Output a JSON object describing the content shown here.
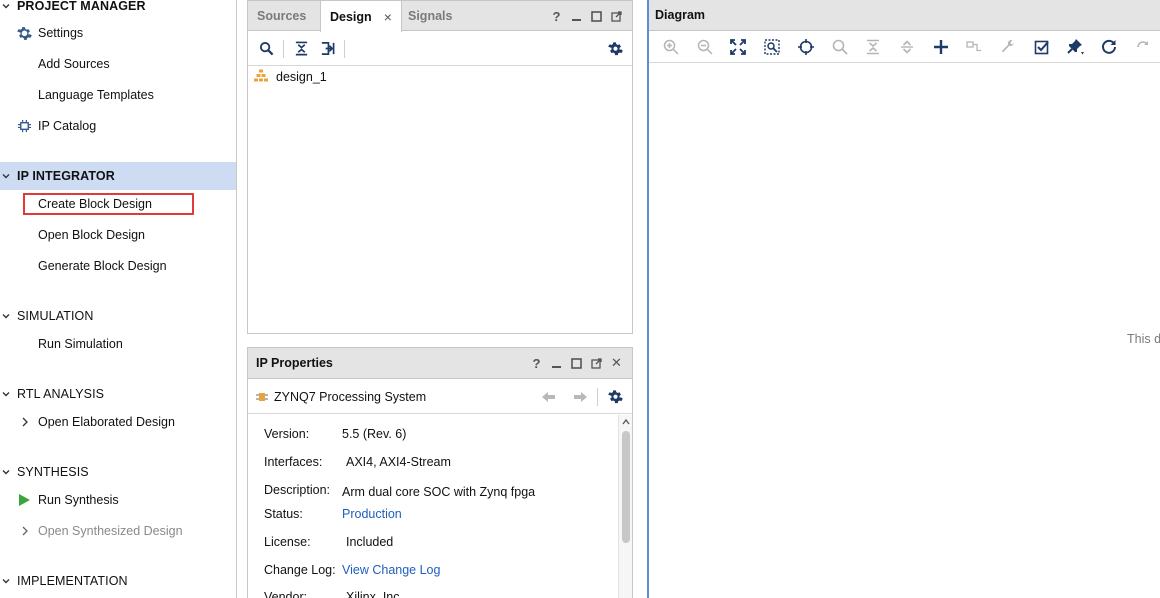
{
  "navigator": {
    "project_manager": {
      "title": "PROJECT MANAGER",
      "items": [
        {
          "label": "Settings",
          "icon": "gear-icon"
        },
        {
          "label": "Add Sources"
        },
        {
          "label": "Language Templates"
        },
        {
          "label": "IP Catalog",
          "icon": "ip-catalog-icon"
        }
      ]
    },
    "ip_integrator": {
      "title": "IP INTEGRATOR",
      "items": [
        {
          "label": "Create Block Design"
        },
        {
          "label": "Open Block Design"
        },
        {
          "label": "Generate Block Design"
        }
      ]
    },
    "simulation": {
      "title": "SIMULATION",
      "items": [
        {
          "label": "Run Simulation"
        }
      ]
    },
    "rtl_analysis": {
      "title": "RTL ANALYSIS",
      "items": [
        {
          "label": "Open Elaborated Design"
        }
      ]
    },
    "synthesis": {
      "title": "SYNTHESIS",
      "items": [
        {
          "label": "Run Synthesis",
          "icon": "run-play-icon"
        },
        {
          "label": "Open Synthesized Design"
        }
      ]
    },
    "implementation": {
      "title": "IMPLEMENTATION"
    }
  },
  "block_design_panel": {
    "tabs": [
      {
        "label": "Sources"
      },
      {
        "label": "Design",
        "close": "×"
      },
      {
        "label": "Signals"
      }
    ],
    "window_controls": {
      "help": "?"
    },
    "tree": [
      {
        "label": "design_1",
        "icon": "hierarchy-icon"
      }
    ]
  },
  "ip_properties": {
    "title": "IP Properties",
    "window_controls": {
      "help": "?",
      "close": "✕"
    },
    "selected_ip": "ZYNQ7 Processing System",
    "properties": [
      {
        "key": "Version:",
        "value": "5.5 (Rev. 6)"
      },
      {
        "key": "Interfaces:",
        "value": "AXI4, AXI4-Stream"
      },
      {
        "key": "Description:",
        "value": "Arm dual core SOC with Zynq fpga"
      },
      {
        "key": "Status:",
        "value": "Production"
      },
      {
        "key": "License:",
        "value": "Included"
      },
      {
        "key": "Change Log:",
        "value": "View Change Log"
      },
      {
        "key": "Vendor:",
        "value": "Xilinx, Inc."
      }
    ]
  },
  "diagram": {
    "title": "Diagram",
    "hint": "This d"
  },
  "colors": {
    "accent_selection": "#cddcf3",
    "highlight_box": "#e03a3a",
    "link": "#1f5fbf",
    "run_green": "#3aa53a",
    "toolbar_icon": "#1e3a66"
  }
}
